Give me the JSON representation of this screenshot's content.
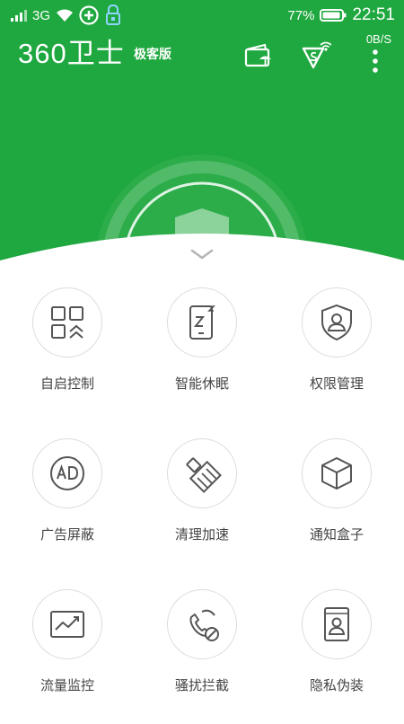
{
  "status_bar": {
    "network": "3G",
    "battery": "77%",
    "time": "22:51"
  },
  "app_bar": {
    "title": "360卫士",
    "subtitle": "极客版",
    "speed": "0B/S"
  },
  "colors": {
    "brand_green": "#1fa83f",
    "icon_gray": "#555555",
    "circle_border": "#dcdcdc"
  },
  "features": [
    {
      "label": "自启控制",
      "icon": "autostart-control-icon"
    },
    {
      "label": "智能休眠",
      "icon": "smart-sleep-icon"
    },
    {
      "label": "权限管理",
      "icon": "permission-manage-icon"
    },
    {
      "label": "广告屏蔽",
      "icon": "ad-block-icon"
    },
    {
      "label": "清理加速",
      "icon": "clean-boost-icon"
    },
    {
      "label": "通知盒子",
      "icon": "notification-box-icon"
    },
    {
      "label": "流量监控",
      "icon": "traffic-monitor-icon"
    },
    {
      "label": "骚扰拦截",
      "icon": "harassment-block-icon"
    },
    {
      "label": "隐私伪装",
      "icon": "privacy-disguise-icon"
    }
  ]
}
